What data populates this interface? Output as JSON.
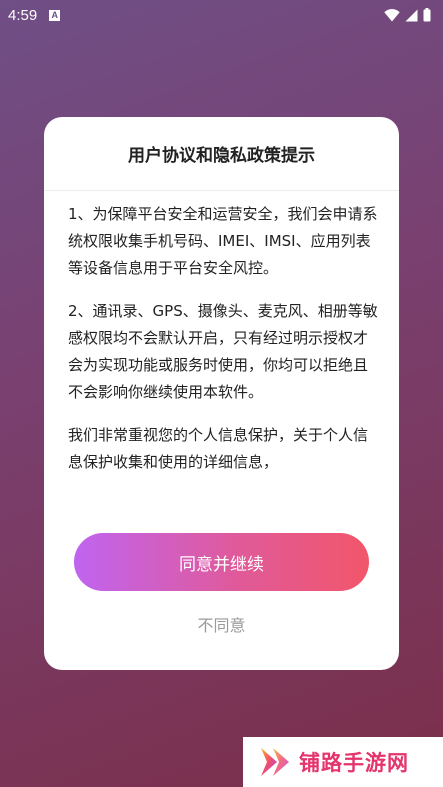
{
  "status_bar": {
    "time": "4:59",
    "notification_icon": "A",
    "icons": [
      "wifi-icon",
      "signal-icon",
      "battery-icon"
    ]
  },
  "dialog": {
    "title": "用户协议和隐私政策提示",
    "paragraphs": [
      "1、为保障平台安全和运营安全，我们会申请系统权限收集手机号码、IMEI、IMSI、应用列表等设备信息用于平台安全风控。",
      "2、通讯录、GPS、摄像头、麦克风、相册等敏感权限均不会默认开启，只有经过明示授权才会为实现功能或服务时使用，你均可以拒绝且不会影响你继续使用本软件。",
      "我们非常重视您的个人信息保护，关于个人信息保护收集和使用的详细信息，"
    ],
    "agree_label": "同意并继续",
    "disagree_label": "不同意"
  },
  "watermark": {
    "text": "铺路手游网"
  },
  "colors": {
    "accent_start": "#c064f0",
    "accent_end": "#f2566a",
    "watermark_text": "#e5336c"
  }
}
